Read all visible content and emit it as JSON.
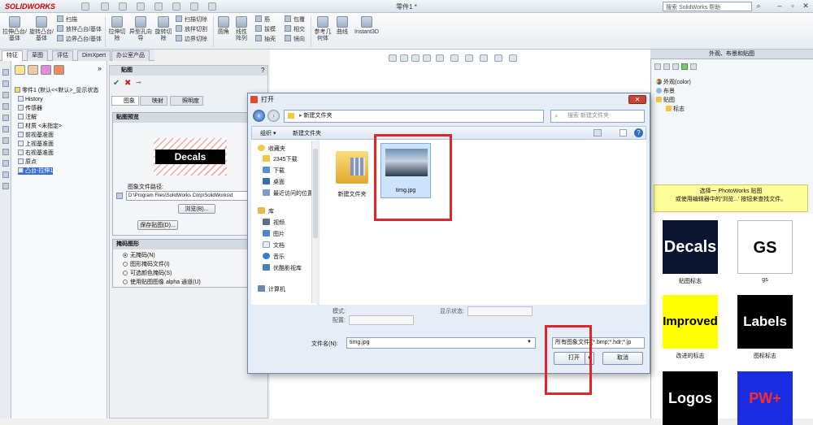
{
  "app": {
    "logo": "SOLIDWORKS",
    "title": "零件1 *",
    "search_placeholder": "搜索 SolidWorks 帮助"
  },
  "ribbon": {
    "big_buttons": [
      "拉伸凸台/基体",
      "旋转凸台/基体",
      "拉伸切除",
      "异型孔向导",
      "旋转切除",
      "圆角",
      "线性阵列",
      "参考几何体",
      "曲线",
      "Instant3D"
    ],
    "small_buttons": [
      "扫描",
      "放样凸台/基体",
      "边界凸台/基体",
      "扫描切除",
      "放样切割",
      "边界切除",
      "筋",
      "拔模",
      "抽壳",
      "包覆",
      "相交",
      "镜向"
    ]
  },
  "tabs": [
    "特征",
    "草图",
    "评估",
    "DimXpert",
    "办公室产品"
  ],
  "tree": {
    "root": "零件1 (默认<<默认>_显示状态",
    "items": [
      "History",
      "传感器",
      "注解",
      "材质 <未指定>",
      "前视基准面",
      "上视基准面",
      "右视基准面",
      "原点",
      "凸台-拉伸1"
    ]
  },
  "property_manager": {
    "title": "贴图",
    "tabs": [
      "图象",
      "映射",
      "照明度"
    ],
    "preview_title": "贴图预览",
    "decal_text": "Decals",
    "path_label": "图象文件路径:",
    "path_value": "D:\\Program Files\\SolidWorks Corp\\SolidWorks\\d",
    "browse_button": "浏览(B)...",
    "save_button": "保存贴图(D)...",
    "mask_title": "掩码图形",
    "mask_options": [
      "无掩码(N)",
      "图形掩码文件(I)",
      "可选颜色掩码(S)",
      "使用贴图图像 alpha 通道(U)"
    ],
    "mask_selected": 0
  },
  "task_pane": {
    "title": "外观、布景和贴图",
    "tree": [
      "外观(color)",
      "布景",
      "贴图",
      "标志"
    ],
    "tip_line1": "选择一 PhotoWorks 贴图",
    "tip_line2": "或使用编辑器中的'浏览...' 按钮来查找文件。",
    "thumbnails": [
      {
        "label": "贴图标志",
        "text": "Decals"
      },
      {
        "label": "gs",
        "text": "GS"
      },
      {
        "label": "改进的标志",
        "text": "Improved"
      },
      {
        "label": "图标标志",
        "text": "Labels"
      },
      {
        "label": "",
        "text": "Logos"
      },
      {
        "label": "",
        "text": "PW+"
      }
    ]
  },
  "dialog": {
    "title": "打开",
    "address": "新建文件夹",
    "search_placeholder": "搜索 新建文件夹",
    "toolbar": {
      "organize": "组织 ▾",
      "new_folder": "新建文件夹"
    },
    "nav": {
      "favorites": "收藏夹",
      "fav_items": [
        "2345下载",
        "下载",
        "桌面",
        "最近访问的位置"
      ],
      "library": "库",
      "lib_items": [
        "视频",
        "图片",
        "文档",
        "音乐",
        "优酷影视库"
      ],
      "computer": "计算机"
    },
    "files": [
      {
        "name": "新建文件夹"
      },
      {
        "name": "timg.jpg"
      }
    ],
    "mode_label": "模式:",
    "config_label": "配置:",
    "display_label": "显示状态:",
    "filename_label": "文件名(N):",
    "filename_value": "timg.jpg",
    "filetype_value": "所有图象文件 (*.bmp;*.hdr;*.jp",
    "open_button": "打开",
    "cancel_button": "取消"
  },
  "colors": {
    "accent": "#3a6fd8",
    "highlight": "#e0242c",
    "tip": "#fdfd9a"
  }
}
